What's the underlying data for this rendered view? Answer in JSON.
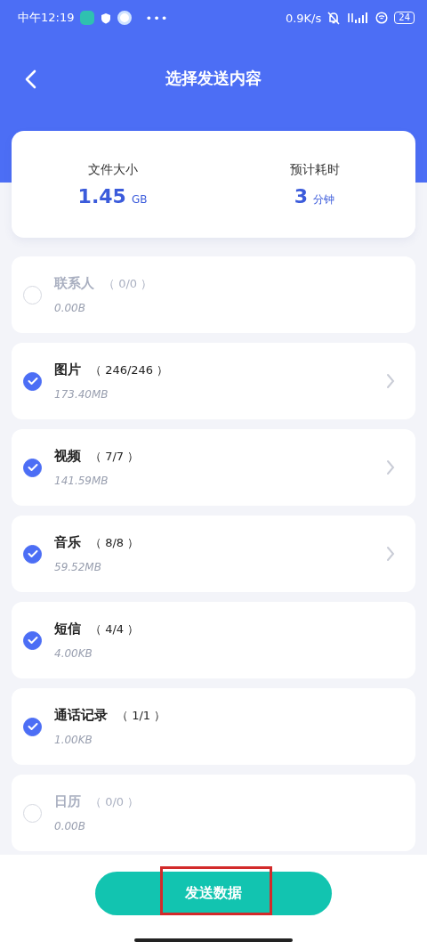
{
  "status_bar": {
    "time": "中午12:19",
    "more": "•••",
    "speed": "0.9K/s",
    "battery": "24"
  },
  "header": {
    "title": "选择发送内容"
  },
  "summary": [
    {
      "label": "文件大小",
      "value": "1.45",
      "unit": "GB"
    },
    {
      "label": "预计耗时",
      "value": "3",
      "unit": "分钟"
    }
  ],
  "items": [
    {
      "name": "联系人",
      "count": "（ 0/0 ）",
      "size": "0.00B",
      "checked": false,
      "disabled": true,
      "chevron": false
    },
    {
      "name": "图片",
      "count": "（ 246/246 ）",
      "size": "173.40MB",
      "checked": true,
      "disabled": false,
      "chevron": true
    },
    {
      "name": "视频",
      "count": "（ 7/7 ）",
      "size": "141.59MB",
      "checked": true,
      "disabled": false,
      "chevron": true
    },
    {
      "name": "音乐",
      "count": "（ 8/8 ）",
      "size": "59.52MB",
      "checked": true,
      "disabled": false,
      "chevron": true
    },
    {
      "name": "短信",
      "count": "（ 4/4 ）",
      "size": "4.00KB",
      "checked": true,
      "disabled": false,
      "chevron": false
    },
    {
      "name": "通话记录",
      "count": "（ 1/1 ）",
      "size": "1.00KB",
      "checked": true,
      "disabled": false,
      "chevron": false
    },
    {
      "name": "日历",
      "count": "（ 0/0 ）",
      "size": "0.00B",
      "checked": false,
      "disabled": true,
      "chevron": false
    }
  ],
  "send_button": {
    "label": "发送数据",
    "highlighted": true
  }
}
